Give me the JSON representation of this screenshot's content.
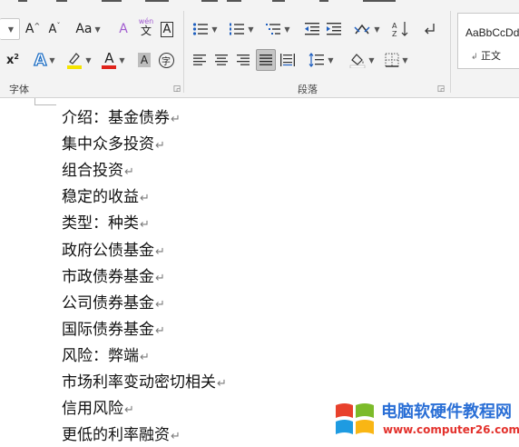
{
  "ribbon": {
    "font_group": {
      "label": "字体",
      "grow_font": "A",
      "shrink_font": "A",
      "change_case": "Aa",
      "clear_format": "A",
      "phonetic_top": "wén",
      "phonetic_bottom": "文",
      "char_border": "A",
      "superscript": "x",
      "text_effect": "A",
      "highlight_color": "#f5e400",
      "font_color_letter": "A",
      "font_color": "#e0241b",
      "char_shading": "A",
      "enclose_char": "字"
    },
    "paragraph_group": {
      "label": "段落"
    },
    "styles_group": {
      "sample": "AaBbCcDd",
      "style_name": "正文"
    }
  },
  "document": {
    "paragraphs": [
      "介绍：基金债券",
      "集中众多投资",
      "组合投资",
      "稳定的收益",
      "类型：种类",
      "政府公债基金",
      "市政债券基金",
      "公司债券基金",
      "国际债券基金",
      "风险：弊端",
      "市场利率变动密切相关",
      "信用风险",
      "更低的利率融资"
    ],
    "paragraph_mark": "↵"
  },
  "watermark": {
    "title": "电脑软硬件教程网",
    "url": "www.computer26.com",
    "logo_colors": [
      "#e8412c",
      "#7cbb2a",
      "#1e9be1",
      "#f9b614"
    ]
  }
}
